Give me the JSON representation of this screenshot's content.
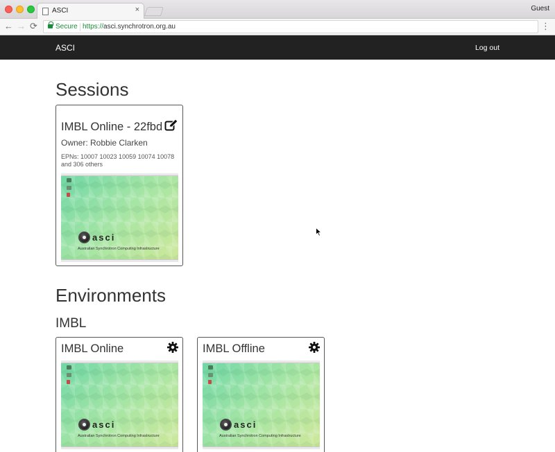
{
  "browser": {
    "tab_title": "ASCI",
    "tab_close": "×",
    "profile": "Guest",
    "secure_label": "Secure",
    "url_scheme": "https://",
    "url_host": "asci.synchrotron.org.au",
    "nav_back": "←",
    "nav_forward": "→",
    "nav_reload": "⟳",
    "menu": "⋮"
  },
  "navbar": {
    "brand": "ASCI",
    "logout_label": "Log out"
  },
  "sessions": {
    "heading": "Sessions",
    "cards": [
      {
        "title": "IMBL Online - 22fbd",
        "owner": "Owner: Robbie Clarken",
        "epns": "EPNs: 10007 10023 10059 10074 10078 and 306 others",
        "icon": "edit-icon"
      }
    ]
  },
  "environments": {
    "heading": "Environments",
    "groups": [
      {
        "name": "IMBL",
        "cards": [
          {
            "title": "IMBL Online",
            "icon": "gear-icon"
          },
          {
            "title": "IMBL Offline",
            "icon": "gear-icon"
          }
        ]
      }
    ]
  },
  "thumbnail": {
    "logo_text": "asci",
    "tagline": "Australian Synchrotron Computing Infrastructure"
  },
  "colors": {
    "navbar_bg": "#222222",
    "secure_green": "#1a8d3a",
    "thumb_green": "#8fdcaf",
    "card_border": "#555555"
  }
}
